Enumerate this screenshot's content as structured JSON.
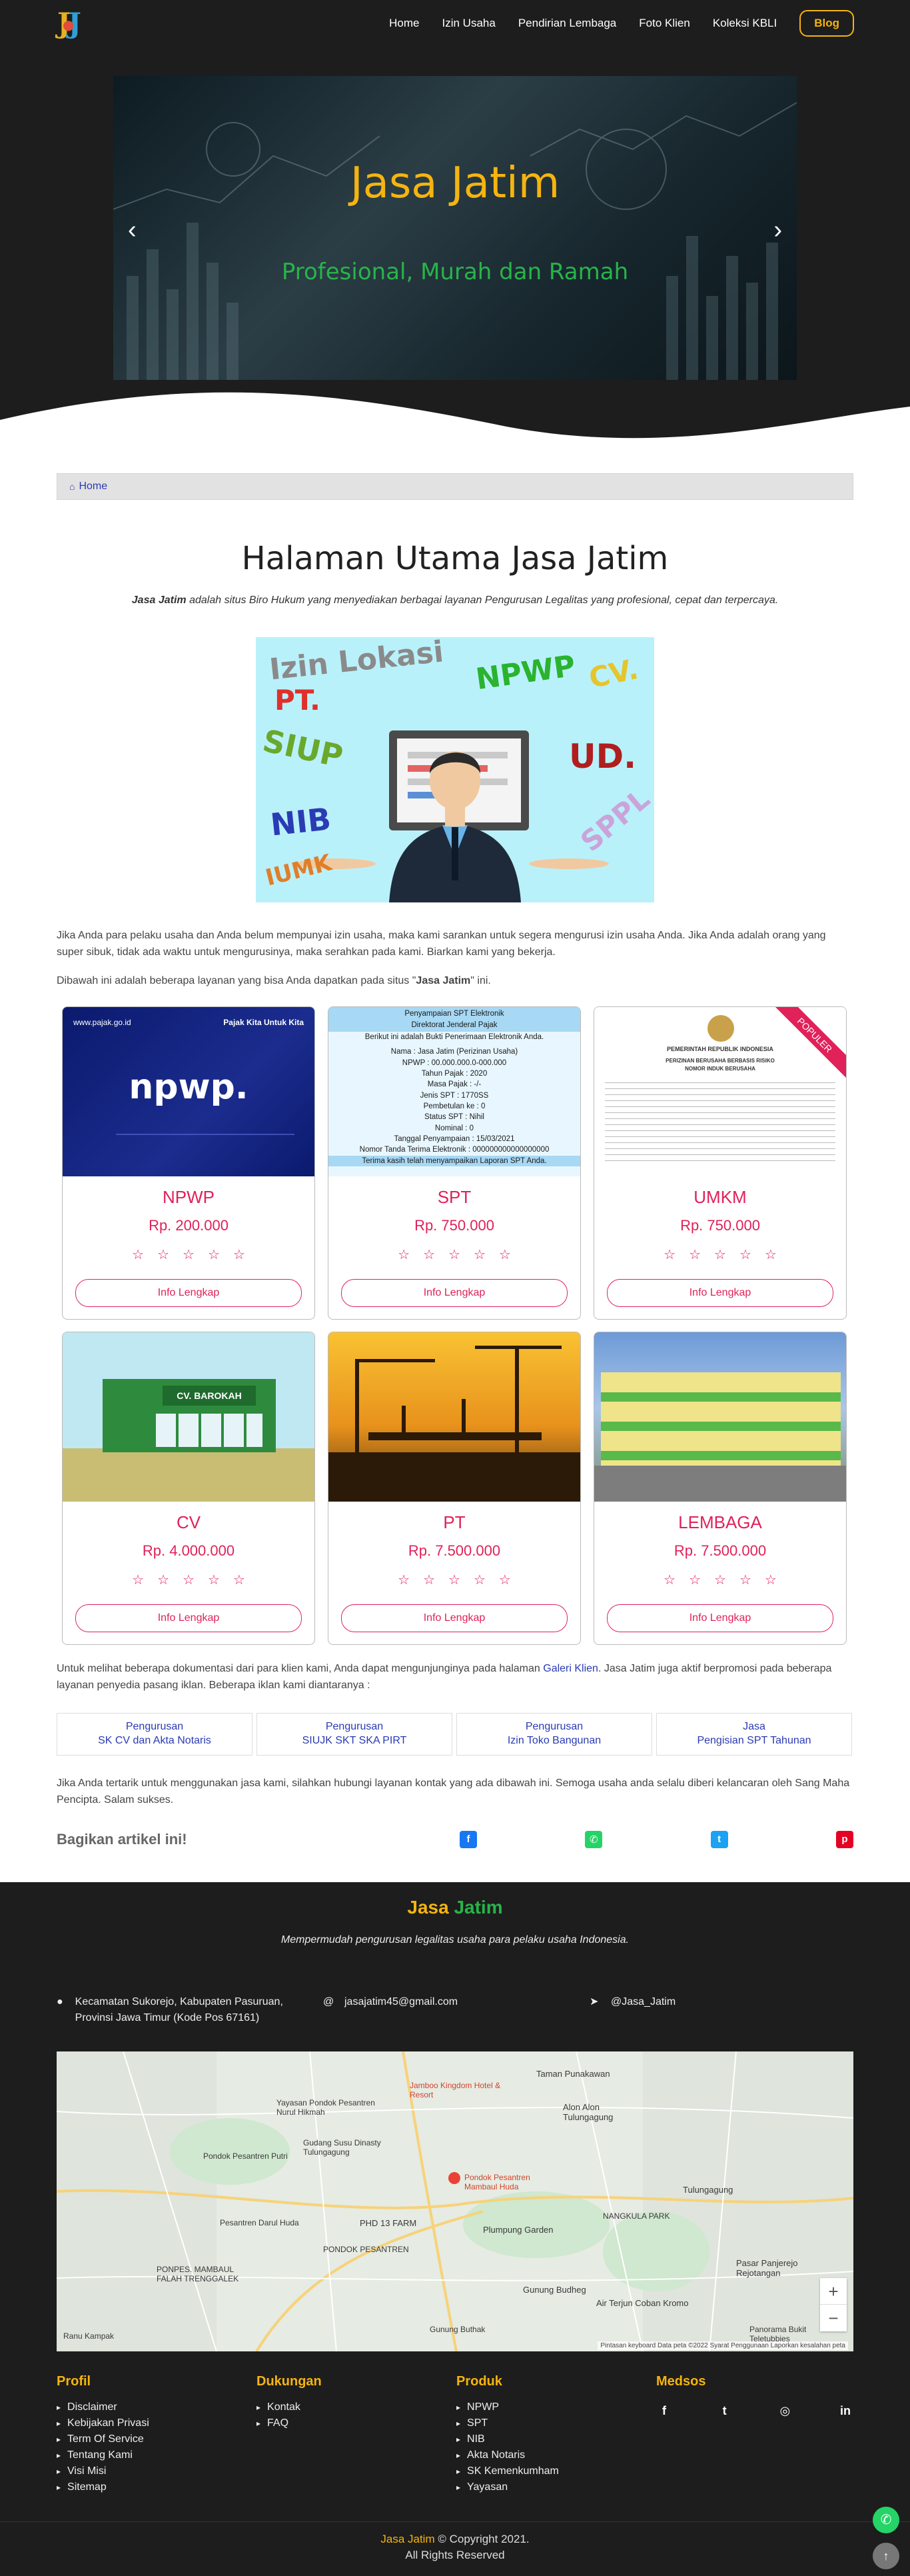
{
  "nav": {
    "items": [
      "Home",
      "Izin Usaha",
      "Pendirian Lembaga",
      "Foto Klien",
      "Koleksi KBLI"
    ],
    "blog": "Blog"
  },
  "slider": {
    "title": "Jasa Jatim",
    "subtitle": "Profesional, Murah dan Ramah",
    "prev": "‹",
    "next": "›"
  },
  "breadcrumb": {
    "home": "Home"
  },
  "main": {
    "title": "Halaman Utama Jasa Jatim",
    "intro_brand": "Jasa Jatim",
    "intro_rest": " adalah situs Biro Hukum yang menyediakan berbagai layanan Pengurusan Legalitas yang profesional, cepat dan terpercaya.",
    "illustration_words": [
      "Izin Lokasi",
      "PT.",
      "NPWP",
      "CV.",
      "SIUP",
      "UD.",
      "NIB",
      "SPPL",
      "IUMK"
    ],
    "para1": "Jika Anda para pelaku usaha dan Anda belum mempunyai izin usaha, maka kami sarankan untuk segera mengurusi izin usaha Anda. Jika Anda adalah orang yang super sibuk, tidak ada waktu untuk mengurusinya, maka serahkan pada kami. Biarkan kami yang bekerja.",
    "para2_a": "Dibawah ini adalah beberapa layanan yang bisa Anda dapatkan pada situs \"",
    "para2_b": "Jasa Jatim",
    "para2_c": "\" ini."
  },
  "cards": [
    {
      "name": "NPWP",
      "price": "Rp. 200.000",
      "button": "Info Lengkap",
      "thumb_top": "www.pajak.go.id",
      "thumb_right": "Pajak Kita Untuk Kita",
      "thumb_logo": "npwp."
    },
    {
      "name": "SPT",
      "price": "Rp. 750.000",
      "button": "Info Lengkap",
      "spt_lines": [
        "Penyampaian SPT Elektronik",
        "Direktorat Jenderal Pajak",
        "Berikut ini adalah Bukti Penerimaan Elektronik Anda.",
        "Nama : Jasa Jatim (Perizinan Usaha)",
        "NPWP : 00.000.000.0-000.000",
        "Tahun Pajak : 2020",
        "Masa Pajak : -/-",
        "Jenis SPT : 1770SS",
        "Pembetulan ke : 0",
        "Status SPT : Nihil",
        "Nominal : 0",
        "Tanggal Penyampaian : 15/03/2021",
        "Nomor Tanda Terima Elektronik : 000000000000000000",
        "Terima kasih telah menyampaikan Laporan SPT Anda."
      ]
    },
    {
      "name": "UMKM",
      "price": "Rp. 750.000",
      "button": "Info Lengkap",
      "ribbon": "POPULER",
      "doc_title": "PEMERINTAH REPUBLIK INDONESIA",
      "doc_sub": "PERIZINAN BERUSAHA BERBASIS RISIKO",
      "doc_no": "NOMOR INDUK BERUSAHA"
    },
    {
      "name": "CV",
      "price": "Rp. 4.000.000",
      "button": "Info Lengkap",
      "sign": "CV. BAROKAH"
    },
    {
      "name": "PT",
      "price": "Rp. 7.500.000",
      "button": "Info Lengkap"
    },
    {
      "name": "LEMBAGA",
      "price": "Rp. 7.500.000",
      "button": "Info Lengkap"
    }
  ],
  "galeri": {
    "text_a": "Untuk melihat beberapa dokumentasi dari para klien kami, Anda dapat mengunjunginya pada halaman ",
    "link": "Galeri Klien",
    "text_b": ". Jasa Jatim juga aktif berpromosi pada beberapa layanan penyedia pasang iklan. Beberapa iklan kami diantaranya :"
  },
  "ads": [
    {
      "l1": "Pengurusan",
      "l2": "SK CV dan Akta Notaris"
    },
    {
      "l1": "Pengurusan",
      "l2": "SIUJK SKT SKA PIRT"
    },
    {
      "l1": "Pengurusan",
      "l2": "Izin Toko Bangunan"
    },
    {
      "l1": "Jasa",
      "l2": "Pengisian SPT Tahunan"
    }
  ],
  "closing": "Jika Anda tertarik untuk menggunakan jasa kami, silahkan hubungi layanan kontak yang ada dibawah ini. Semoga usaha anda selalu diberi kelancaran oleh Sang Maha Pencipta. Salam sukses.",
  "share": {
    "label": "Bagikan artikel ini!"
  },
  "footer": {
    "brand_a": "Jasa ",
    "brand_b": "Jatim",
    "tagline": "Mempermudah pengurusan legalitas usaha para pelaku usaha Indonesia.",
    "address": "Kecamatan Sukorejo, Kabupaten Pasuruan, Provinsi Jawa Timur (Kode Pos 67161)",
    "email": "jasajatim45@gmail.com",
    "telegram": "@Jasa_Jatim",
    "map": {
      "labels": [
        "Taman Punakawan",
        "Jamboo Kingdom Hotel & Resort",
        "Yayasan Pondok Pesantren Nurul Hikmah",
        "Alon Alon Tulungagung",
        "Gudang Susu Dinasty Tulungagung",
        "Pondok Pesantren Putri",
        "Pondok Pesantren Mambaul Huda",
        "PHD 13 FARM",
        "Pesantren Darul Huda",
        "Plumpung Garden",
        "NANGKULA PARK",
        "PONDOK PESANTREN",
        "Gunung Budheg",
        "Tulungagung",
        "PONPES. MAMBAUL FALAH TRENGGALEK",
        "Air Terjun Coban Kromo",
        "Pasar Panjerejo Rejotangan",
        "Panorama Bukit Teletubbies",
        "Gunung Buthak",
        "Ranu Kampak"
      ],
      "footer": "Pintasan keyboard   Data peta ©2022   Syarat Penggunaan   Laporkan kesalahan peta",
      "zoom_in": "+",
      "zoom_out": "−"
    },
    "columns": [
      {
        "title": "Profil",
        "items": [
          "Disclaimer",
          "Kebijakan Privasi",
          "Term Of Service",
          "Tentang Kami",
          "Visi Misi",
          "Sitemap"
        ]
      },
      {
        "title": "Dukungan",
        "items": [
          "Kontak",
          "FAQ"
        ]
      },
      {
        "title": "Produk",
        "items": [
          "NPWP",
          "SPT",
          "NIB",
          "Akta Notaris",
          "SK Kemenkumham",
          "Yayasan"
        ]
      },
      {
        "title": "Medsos",
        "items": []
      }
    ],
    "copyright_brand": "Jasa Jatim",
    "copyright_rest": " © Copyright 2021.",
    "copyright_line2": "All Rights Reserved"
  },
  "colors": {
    "accent": "#e0215a",
    "brand_yellow": "#f5b40f",
    "brand_green": "#28b44a",
    "link": "#2a3ab3",
    "dark": "#1d1d1d"
  }
}
